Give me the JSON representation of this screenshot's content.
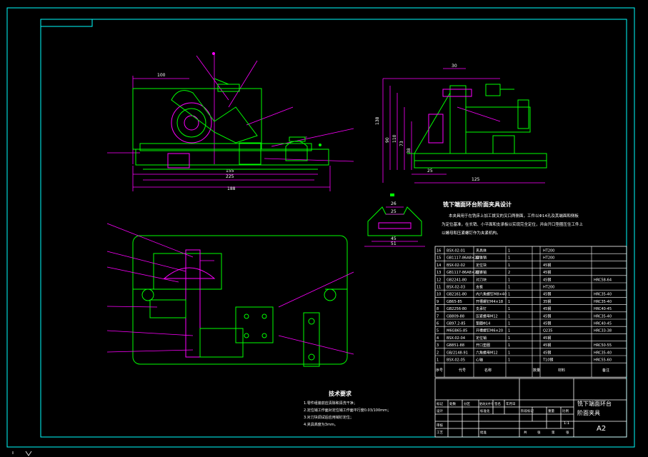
{
  "colors": {
    "background": "#000000",
    "frame": "#00ffff",
    "part": "#00ff00",
    "dimension": "#ff00ff",
    "text": "#ffffff",
    "leader": "#ff00ff"
  },
  "views": {
    "front_dims": {
      "d100": "100",
      "d155": "155",
      "d225": "225",
      "d188": "188"
    },
    "side_dims": {
      "d30": "30",
      "d25": "25",
      "d125": "125",
      "d138": "138",
      "d90": "90",
      "d110": "110",
      "d73": "73",
      "d38": "38"
    },
    "detail_dims": {
      "d26": "26",
      "d25": "25",
      "d45": "45",
      "d51": "51"
    }
  },
  "title_text": {
    "heading": "铣下端面环台阶面夹具设计",
    "description_1": "本夹具用于在铣床上加工拨叉的叉口两侧面，工件以Φ14孔及其端面和侧板",
    "description_2": "为定位基准，在长销、小平面和支承板以实现完全定位，并由开口垫圈压住工件上",
    "description_3": "以螺母和压紧螺钉作为夹紧机构。"
  },
  "tech_requirements": {
    "title": "技术要求",
    "items": [
      "1.零件组装前应清除和清洗干净；",
      "2.定位销工作面对定位销工作面平行度0.03/100mm；",
      "3.对刀块调试后应用销钉定位；",
      "4.夹具高度为3mm。"
    ]
  },
  "bom": {
    "rows": [
      {
        "no": "16",
        "code": "BSX-02-01",
        "name": "夹具体",
        "qty": "1",
        "material": "HT200",
        "note": ""
      },
      {
        "no": "15",
        "code": "GB1117-86A8×20",
        "name": "圆锥销",
        "qty": "1",
        "material": "HT200",
        "note": ""
      },
      {
        "no": "14",
        "code": "BSX-02-02",
        "name": "定位块",
        "qty": "1",
        "material": "45钢",
        "note": ""
      },
      {
        "no": "13",
        "code": "GB1117-86A8×20",
        "name": "圆锥销",
        "qty": "2",
        "material": "45钢",
        "note": ""
      },
      {
        "no": "12",
        "code": "GB2241-80",
        "name": "对刀块",
        "qty": "1",
        "material": "45钢",
        "note": "HRC58-64"
      },
      {
        "no": "11",
        "code": "BSX-02-03",
        "name": "支板",
        "qty": "1",
        "material": "HT200",
        "note": ""
      },
      {
        "no": "10",
        "code": "GB2161-80",
        "name": "内六角螺钉M8×40",
        "qty": "1",
        "material": "45钢",
        "note": "HRC35-40"
      },
      {
        "no": "9",
        "code": "GB65-85",
        "name": "开槽螺钉M4×18",
        "qty": "1",
        "material": "35钢",
        "note": "HRC35-40"
      },
      {
        "no": "8",
        "code": "GB2256-80",
        "name": "支承钉",
        "qty": "1",
        "material": "45钢",
        "note": "HRC40-45"
      },
      {
        "no": "7",
        "code": "GB809-88",
        "name": "压紧螺母M12",
        "qty": "1",
        "material": "45钢",
        "note": "HRC35-40"
      },
      {
        "no": "6",
        "code": "GB97.2-85",
        "name": "垫圈Φ14",
        "qty": "1",
        "material": "45钢",
        "note": "HRC40-45"
      },
      {
        "no": "5",
        "code": "M6GB65-85",
        "name": "开槽螺钉M6×20",
        "qty": "1",
        "material": "Q235",
        "note": "HRC33-38"
      },
      {
        "no": "4",
        "code": "BSX-02-04",
        "name": "定位销",
        "qty": "1",
        "material": "45钢",
        "note": ""
      },
      {
        "no": "3",
        "code": "GB851-88",
        "name": "开口垫圈",
        "qty": "1",
        "material": "45钢",
        "note": "HRC50-55"
      },
      {
        "no": "2",
        "code": "GB/2148-91",
        "name": "六角螺母M12",
        "qty": "1",
        "material": "45钢",
        "note": "HRC35-40"
      },
      {
        "no": "1",
        "code": "BSX-02-05",
        "name": "心轴",
        "qty": "1",
        "material": "T10钢",
        "note": "HRC55-60"
      }
    ],
    "header": {
      "no": "序号",
      "code": "代号",
      "name": "名称",
      "qty": "数量",
      "material": "材料",
      "note": "备注"
    }
  },
  "title_block": {
    "drawing_title_1": "铣下端面环台",
    "drawing_title_2": "阶面夹具",
    "sheet_size": "A2",
    "scale": "1:1",
    "labels": [
      "标记",
      "处数",
      "分区",
      "更改文件号",
      "签名",
      "年月日",
      "设计",
      "标准化",
      "审核",
      "工艺",
      "批准",
      "阶段标记",
      "重量",
      "比例",
      "共",
      "张",
      "第",
      "张"
    ]
  }
}
